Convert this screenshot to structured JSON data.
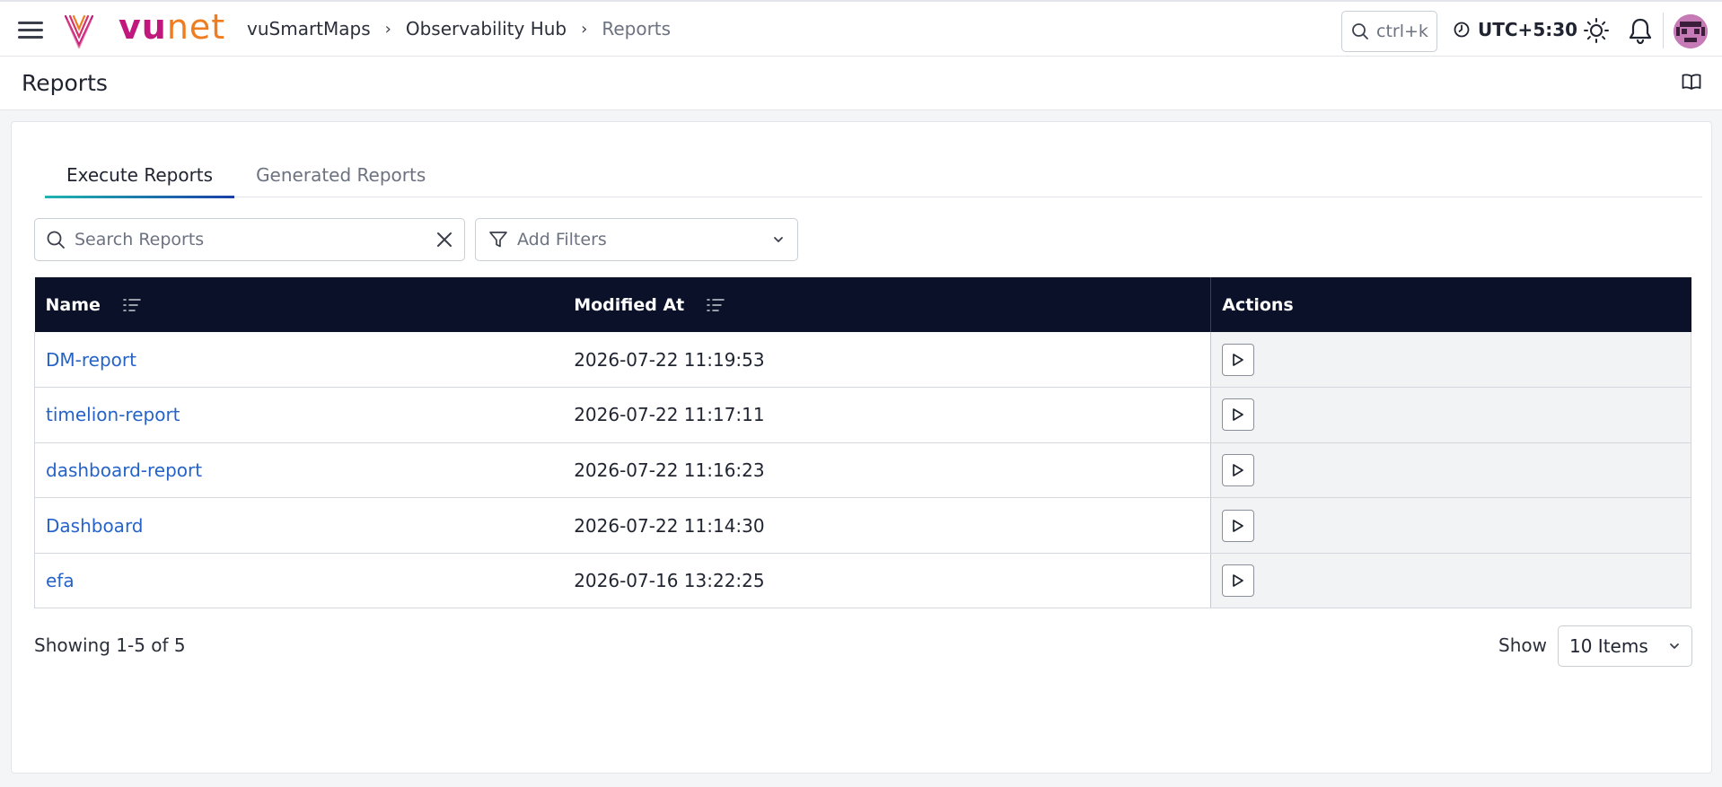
{
  "brand": {
    "logo_v": "vu",
    "logo_rest": "net"
  },
  "breadcrumb": [
    "vuSmartMaps",
    "Observability Hub",
    "Reports"
  ],
  "topbar": {
    "search_hint": "ctrl+k",
    "timezone": "UTC+5:30"
  },
  "page": {
    "title": "Reports"
  },
  "tabs": [
    {
      "label": "Execute Reports",
      "active": true
    },
    {
      "label": "Generated Reports",
      "active": false
    }
  ],
  "search": {
    "placeholder": "Search Reports",
    "value": ""
  },
  "filters": {
    "label": "Add Filters"
  },
  "table": {
    "columns": [
      "Name",
      "Modified At",
      "Actions"
    ],
    "rows": [
      {
        "name": "DM-report",
        "modified_at": "2026-07-22 11:19:53"
      },
      {
        "name": "timelion-report",
        "modified_at": "2026-07-22 11:17:11"
      },
      {
        "name": "dashboard-report",
        "modified_at": "2026-07-22 11:16:23"
      },
      {
        "name": "Dashboard",
        "modified_at": "2026-07-22 11:14:30"
      },
      {
        "name": "efa",
        "modified_at": "2026-07-16 13:22:25"
      }
    ]
  },
  "pagination": {
    "showing": "Showing 1-5 of 5",
    "show_label": "Show",
    "items_per_page": "10 Items"
  },
  "colors": {
    "header_bg": "#0b1128",
    "link": "#2563c9",
    "brand_magenta": "#c0187c",
    "brand_orange": "#ee7d22"
  }
}
